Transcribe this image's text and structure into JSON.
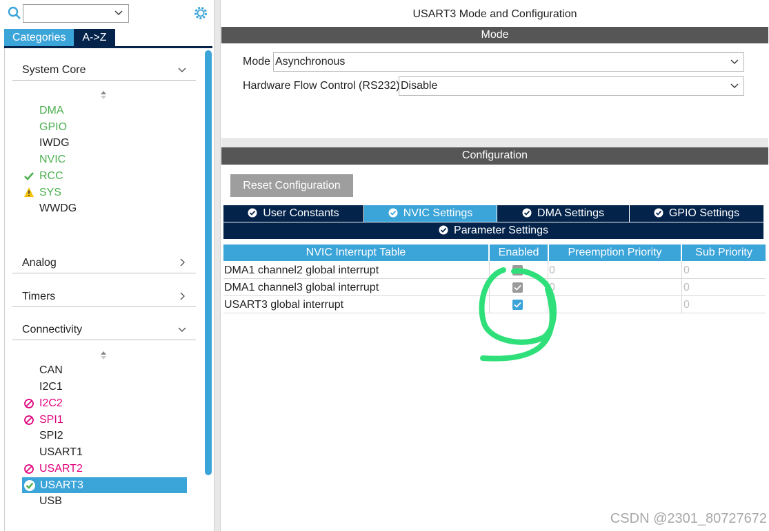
{
  "left": {
    "search": {
      "value": ""
    },
    "tabs": [
      {
        "label": "Categories",
        "active": true
      },
      {
        "label": "A->Z",
        "active": false
      }
    ],
    "sections": {
      "system_core": {
        "label": "System Core",
        "items": [
          {
            "label": "DMA",
            "status": "green"
          },
          {
            "label": "GPIO",
            "status": "green"
          },
          {
            "label": "IWDG",
            "status": "none"
          },
          {
            "label": "NVIC",
            "status": "green"
          },
          {
            "label": "RCC",
            "status": "check"
          },
          {
            "label": "SYS",
            "status": "warning"
          },
          {
            "label": "WWDG",
            "status": "none"
          }
        ]
      },
      "analog": {
        "label": "Analog"
      },
      "timers": {
        "label": "Timers"
      },
      "connectivity": {
        "label": "Connectivity",
        "items": [
          {
            "label": "CAN",
            "status": "none"
          },
          {
            "label": "I2C1",
            "status": "none"
          },
          {
            "label": "I2C2",
            "status": "blocked"
          },
          {
            "label": "SPI1",
            "status": "blocked"
          },
          {
            "label": "SPI2",
            "status": "none"
          },
          {
            "label": "USART1",
            "status": "none"
          },
          {
            "label": "USART2",
            "status": "blocked"
          },
          {
            "label": "USART3",
            "status": "selected-check"
          },
          {
            "label": "USB",
            "status": "none"
          }
        ]
      }
    }
  },
  "right": {
    "title": "USART3 Mode and Configuration",
    "mode_bar": "Mode",
    "mode": {
      "label": "Mode",
      "value": "Asynchronous"
    },
    "flow": {
      "label": "Hardware Flow Control (RS232)",
      "value": "Disable"
    },
    "config_bar": "Configuration",
    "reset_button": "Reset Configuration",
    "tabs": [
      {
        "label": "User Constants",
        "active": false
      },
      {
        "label": "NVIC Settings",
        "active": true
      },
      {
        "label": "DMA Settings",
        "active": false
      },
      {
        "label": "GPIO Settings",
        "active": false
      },
      {
        "label": "Parameter Settings",
        "active": false
      }
    ],
    "table": {
      "headers": [
        "NVIC Interrupt Table",
        "Enabled",
        "Preemption Priority",
        "Sub Priority"
      ],
      "rows": [
        {
          "name": "DMA1 channel2 global interrupt",
          "enabled": true,
          "locked": true,
          "preemption": "0",
          "sub": "0"
        },
        {
          "name": "DMA1 channel3 global interrupt",
          "enabled": true,
          "locked": true,
          "preemption": "0",
          "sub": "0"
        },
        {
          "name": "USART3 global interrupt",
          "enabled": true,
          "locked": false,
          "preemption": "",
          "sub": "0"
        }
      ]
    }
  },
  "watermark": "CSDN @2301_80727672",
  "colors": {
    "accent": "#3ba4d9",
    "navy": "#03234b",
    "bar": "#565656",
    "green": "#4caf50",
    "pink": "#e0007a",
    "annotation": "#2fe07a"
  }
}
